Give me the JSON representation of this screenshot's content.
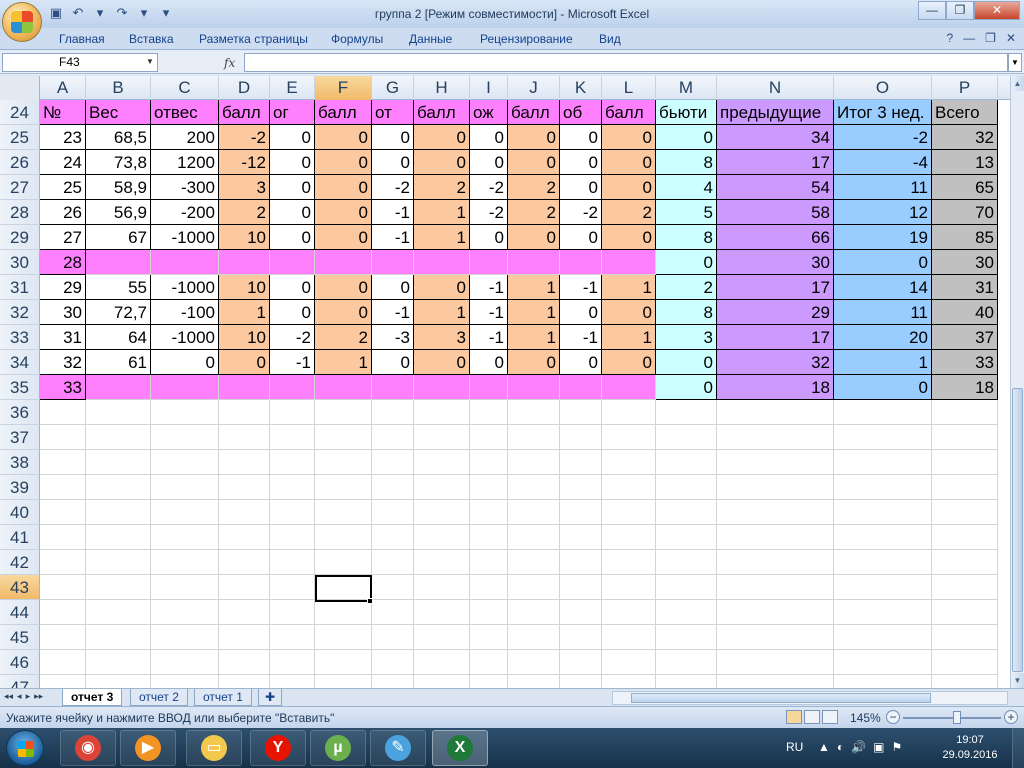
{
  "window": {
    "title": "группа 2  [Режим совместимости] - Microsoft Excel",
    "controls": {
      "minimize": "—",
      "restore": "❐",
      "close": "✕"
    }
  },
  "qat": {
    "save_icon": "save-icon",
    "undo_icon": "undo-icon",
    "redo_icon": "redo-icon",
    "undo_glyph": "↶",
    "redo_glyph": "↷",
    "save_glyph": "▣",
    "menu_glyph": "▾"
  },
  "ribbon": {
    "tabs": [
      "Главная",
      "Вставка",
      "Разметка страницы",
      "Формулы",
      "Данные",
      "Рецензирование",
      "Вид"
    ],
    "help_glyph": "?",
    "min_glyph": "—",
    "restore_glyph": "❐",
    "close_glyph": "✕"
  },
  "formula_bar": {
    "name_box": "F43",
    "fx": "fx",
    "formula": ""
  },
  "columns": [
    "A",
    "B",
    "C",
    "D",
    "E",
    "F",
    "G",
    "H",
    "I",
    "J",
    "K",
    "L",
    "M",
    "N",
    "O",
    "P"
  ],
  "active_column": "F",
  "active_row": "43",
  "colors": {
    "pink": "#ff80ff",
    "white": "#ffffff",
    "peach": "#fcc8a0",
    "cyan": "#ccffff",
    "lavender": "#cc99ff",
    "blue": "#99ccff",
    "gray": "#c0c0c0"
  },
  "header_row": {
    "row": "24",
    "cells": [
      "№",
      "Вес",
      "отвес",
      "балл",
      "ог",
      "балл",
      "от",
      "балл",
      "ож",
      "балл",
      "об",
      "балл",
      "бьюти",
      "предыдущие",
      "Итог 3 нед.",
      "Всего"
    ]
  },
  "data_rows": [
    {
      "row": "25",
      "cells": [
        "23",
        "68,5",
        "200",
        "-2",
        "0",
        "0",
        "0",
        "0",
        "0",
        "0",
        "0",
        "0",
        "0",
        "34",
        "-2",
        "32"
      ],
      "pink": false
    },
    {
      "row": "26",
      "cells": [
        "24",
        "73,8",
        "1200",
        "-12",
        "0",
        "0",
        "0",
        "0",
        "0",
        "0",
        "0",
        "0",
        "8",
        "17",
        "-4",
        "13"
      ],
      "pink": false
    },
    {
      "row": "27",
      "cells": [
        "25",
        "58,9",
        "-300",
        "3",
        "0",
        "0",
        "-2",
        "2",
        "-2",
        "2",
        "0",
        "0",
        "4",
        "54",
        "11",
        "65"
      ],
      "pink": false
    },
    {
      "row": "28",
      "cells": [
        "26",
        "56,9",
        "-200",
        "2",
        "0",
        "0",
        "-1",
        "1",
        "-2",
        "2",
        "-2",
        "2",
        "5",
        "58",
        "12",
        "70"
      ],
      "pink": false
    },
    {
      "row": "29",
      "cells": [
        "27",
        "67",
        "-1000",
        "10",
        "0",
        "0",
        "-1",
        "1",
        "0",
        "0",
        "0",
        "0",
        "8",
        "66",
        "19",
        "85"
      ],
      "pink": false
    },
    {
      "row": "30",
      "cells": [
        "28",
        "",
        "",
        "",
        "",
        "",
        "",
        "",
        "",
        "",
        "",
        "",
        "0",
        "30",
        "0",
        "30"
      ],
      "pink": true
    },
    {
      "row": "31",
      "cells": [
        "29",
        "55",
        "-1000",
        "10",
        "0",
        "0",
        "0",
        "0",
        "-1",
        "1",
        "-1",
        "1",
        "2",
        "17",
        "14",
        "31"
      ],
      "pink": false
    },
    {
      "row": "32",
      "cells": [
        "30",
        "72,7",
        "-100",
        "1",
        "0",
        "0",
        "-1",
        "1",
        "-1",
        "1",
        "0",
        "0",
        "8",
        "29",
        "11",
        "40"
      ],
      "pink": false
    },
    {
      "row": "33",
      "cells": [
        "31",
        "64",
        "-1000",
        "10",
        "-2",
        "2",
        "-3",
        "3",
        "-1",
        "1",
        "-1",
        "1",
        "3",
        "17",
        "20",
        "37"
      ],
      "pink": false
    },
    {
      "row": "34",
      "cells": [
        "32",
        "61",
        "0",
        "0",
        "-1",
        "1",
        "0",
        "0",
        "0",
        "0",
        "0",
        "0",
        "0",
        "32",
        "1",
        "33"
      ],
      "pink": false
    },
    {
      "row": "35",
      "cells": [
        "33",
        "",
        "",
        "",
        "",
        "",
        "",
        "",
        "",
        "",
        "",
        "",
        "0",
        "18",
        "0",
        "18"
      ],
      "pink": true
    }
  ],
  "empty_rows": [
    "36",
    "37",
    "38",
    "39",
    "40",
    "41",
    "42",
    "43",
    "44",
    "45",
    "46",
    "47"
  ],
  "sheets": {
    "tabs": [
      "отчет 3",
      "отчет 2",
      "отчет 1"
    ],
    "active": "отчет 3",
    "nav": [
      "◂◂",
      "◂",
      "▸",
      "▸▸"
    ]
  },
  "status": {
    "message": "Укажите ячейку и нажмите ВВОД или выберите \"Вставить\"",
    "zoom": "145%",
    "zoom_minus": "−",
    "zoom_plus": "+"
  },
  "taskbar": {
    "lang": "RU",
    "time": "19:07",
    "date": "29.09.2016",
    "apps": [
      {
        "name": "chrome-icon",
        "glyph": "◉",
        "color": "#db4437"
      },
      {
        "name": "media-player-icon",
        "glyph": "▶",
        "color": "#f29423"
      },
      {
        "name": "explorer-icon",
        "glyph": "▭",
        "color": "#f2c94c"
      },
      {
        "name": "yandex-icon",
        "glyph": "Y",
        "color": "#e61400"
      },
      {
        "name": "utorrent-icon",
        "glyph": "µ",
        "color": "#6ab04c"
      },
      {
        "name": "paint-icon",
        "glyph": "✎",
        "color": "#4aa3df"
      },
      {
        "name": "excel-icon",
        "glyph": "X",
        "color": "#1f7a3a"
      }
    ],
    "tray_icons": [
      "▲",
      "◐",
      "🔊",
      "▣",
      "⚑"
    ]
  }
}
